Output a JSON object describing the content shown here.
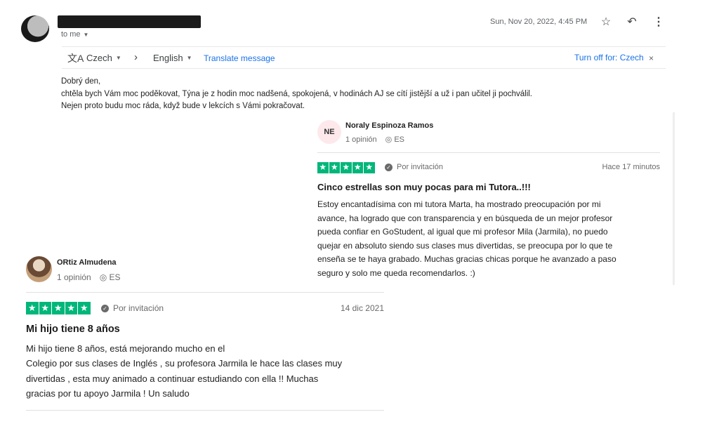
{
  "header": {
    "recipient": "to me",
    "date": "Sun, Nov 20, 2022, 4:45 PM",
    "icons": [
      "star-icon",
      "reply-icon",
      "more-icon"
    ]
  },
  "translate_bar": {
    "from_lang": "Czech",
    "to_lang": "English",
    "translate_link": "Translate message",
    "turn_off": "Turn off for: Czech",
    "close": "×"
  },
  "email": {
    "lines": [
      "Dobrý den,",
      "chtěla bych Vám moc poděkovat, Týna je z hodin moc nadšená, spokojená, v hodinách AJ se cítí jistější a už i pan učitel ji pochválil.",
      "Nejen proto budu moc ráda, když bude v lekcích s Vámi pokračovat."
    ]
  },
  "reviews": [
    {
      "initials": "NE",
      "name": "Noraly Espinoza Ramos",
      "opinions": "1 opinión",
      "country": "ES",
      "stars": 5,
      "invite": "Por invitación",
      "when": "Hace 17 minutos",
      "title": "Cinco estrellas son muy pocas para mi Tutora..!!!",
      "text_lines": [
        "Estoy encantadísima con mi tutora Marta, ha mostrado preocupación por mi",
        "avance, ha logrado que con transparencia y en búsqueda de un mejor profesor",
        "pueda confiar en GoStudent, al igual que mi profesor Mila (Jarmila), no puedo",
        "quejar en absoluto siendo sus clases mus divertidas, se preocupa por lo que te",
        "enseña se te haya grabado. Muchas gracias chicas porque he avanzado a paso",
        "seguro y solo me queda recomendarlos. :)"
      ]
    },
    {
      "name": "ORtiz Almudena",
      "opinions": "1 opinión",
      "country": "ES",
      "stars": 5,
      "invite": "Por invitación",
      "when": "14 dic 2021",
      "title": "Mi hijo tiene 8 años",
      "text_lines": [
        "Mi hijo tiene 8 años, está mejorando mucho en el",
        "Colegio por sus clases de Inglés , su profesora Jarmila le hace las clases muy",
        "divertidas , esta muy animado a continuar estudiando con ella !! Muchas",
        "gracias por tu apoyo Jarmila ! Un saludo"
      ]
    }
  ],
  "colors": {
    "trustpilot_green": "#00b67a",
    "link_blue": "#1a73e8"
  }
}
